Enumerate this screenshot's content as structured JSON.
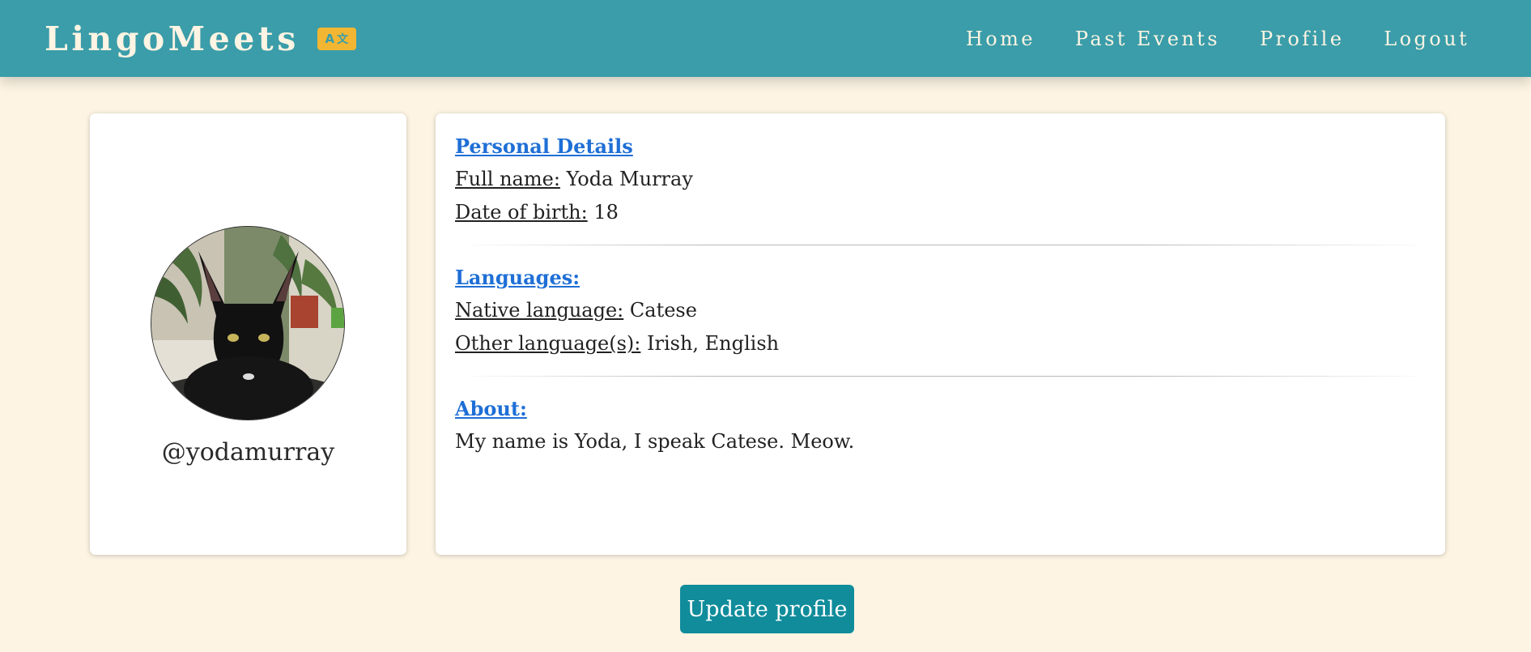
{
  "brand": {
    "name": "LingoMeets",
    "icon": "translate-icon",
    "icon_glyphs": [
      "A",
      "文"
    ]
  },
  "nav": {
    "items": [
      "Home",
      "Past Events",
      "Profile",
      "Logout"
    ]
  },
  "profile": {
    "username": "@yodamurray",
    "avatar": "black-cat-photo"
  },
  "details": {
    "personal_heading": "Personal Details",
    "full_name_label": "Full name:",
    "full_name": "Yoda Murray",
    "dob_label": "Date of birth:",
    "dob": "18",
    "languages_heading": "Languages:",
    "native_label": "Native language:",
    "native": "Catese",
    "other_label": "Other language(s):",
    "other": "Irish, English",
    "about_heading": "About:",
    "about": "My name is Yoda, I speak Catese. Meow."
  },
  "actions": {
    "update_label": "Update profile"
  },
  "colors": {
    "navbar": "#3a9da9",
    "background": "#fdf4e3",
    "accent_icon": "#f2b632",
    "link": "#1f6fd6",
    "button": "#108c9b"
  }
}
